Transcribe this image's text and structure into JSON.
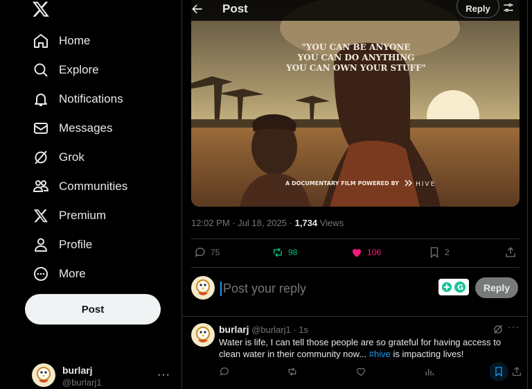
{
  "sidebar": {
    "items": [
      {
        "label": "Home",
        "icon": "home-icon"
      },
      {
        "label": "Explore",
        "icon": "search-icon"
      },
      {
        "label": "Notifications",
        "icon": "bell-icon"
      },
      {
        "label": "Messages",
        "icon": "envelope-icon"
      },
      {
        "label": "Grok",
        "icon": "grok-icon"
      },
      {
        "label": "Communities",
        "icon": "people-icon"
      },
      {
        "label": "Premium",
        "icon": "x-logo-icon"
      },
      {
        "label": "Profile",
        "icon": "person-icon"
      },
      {
        "label": "More",
        "icon": "more-circle-icon"
      }
    ],
    "post_label": "Post",
    "account": {
      "name": "burlarj",
      "handle": "@burlarj1",
      "more": "···"
    }
  },
  "header": {
    "title": "Post",
    "reply_label": "Reply"
  },
  "media": {
    "quote_line1": "\"YOU CAN BE ANYONE",
    "quote_line2": "YOU CAN DO ANYTHING",
    "quote_line3": "YOU CAN OWN YOUR STUFF\"",
    "caption": "A DOCUMENTARY FILM POWERED BY",
    "brand": "HIVE"
  },
  "post_meta": {
    "time_date": "12:02 PM · Jul 18, 2025 · ",
    "views_count": "1,734",
    "views_label": " Views"
  },
  "actions": {
    "replies": "75",
    "reposts": "98",
    "likes": "106",
    "bookmarks": "2"
  },
  "compose": {
    "placeholder": "Post your reply",
    "reply_label": "Reply"
  },
  "reply_tweet": {
    "name": "burlarj",
    "handle_time": " @burlarj1 · 1s",
    "text_before": "Water is life, I can tell those people are so grateful for having access to clean water in their community now... ",
    "hashtag": "#hive",
    "text_after": " is impacting lives!",
    "more": "···"
  },
  "colors": {
    "accent": "#1d9bf0",
    "repost": "#00ba7c",
    "like": "#f91880",
    "bg": "#000000"
  }
}
